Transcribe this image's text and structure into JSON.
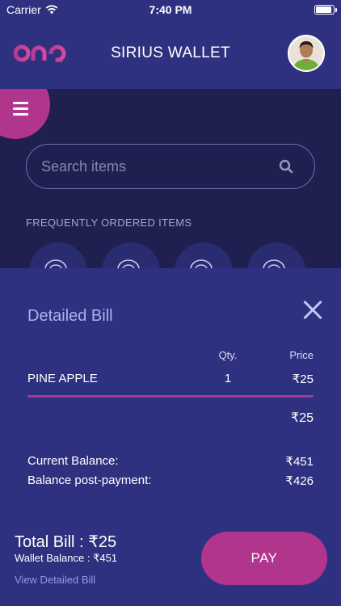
{
  "status_bar": {
    "carrier": "Carrier",
    "time": "7:40 PM",
    "battery_level": 0.9
  },
  "header": {
    "logo_icon": "one-logo",
    "title": "SIRIUS WALLET",
    "avatar_icon": "user-avatar"
  },
  "menu": {
    "icon": "hamburger-menu-icon"
  },
  "search": {
    "placeholder": "Search items",
    "icon": "search-icon"
  },
  "frequently_ordered": {
    "label": "FREQUENTLY ORDERED ITEMS",
    "item_icons": [
      "food-icon",
      "food-icon",
      "food-icon",
      "food-icon"
    ]
  },
  "bill": {
    "title": "Detailed Bill",
    "close_icon": "close-icon",
    "qty_header": "Qty.",
    "price_header": "Price",
    "items": [
      {
        "name": "PINE APPLE",
        "qty": "1",
        "price": "₹25"
      }
    ],
    "subtotal": "₹25",
    "current_balance_label": "Current Balance:",
    "current_balance_value": "₹451",
    "post_payment_label": "Balance post-payment:",
    "post_payment_value": "₹426"
  },
  "footer": {
    "total_bill": "Total Bill : ₹25",
    "wallet_balance": "Wallet Balance : ₹451",
    "view_detailed_bill": "View Detailed Bill",
    "pay_label": "PAY"
  },
  "colors": {
    "primary_bg": "#2e3180",
    "dark_bg": "#1f2050",
    "accent": "#b1348d"
  }
}
